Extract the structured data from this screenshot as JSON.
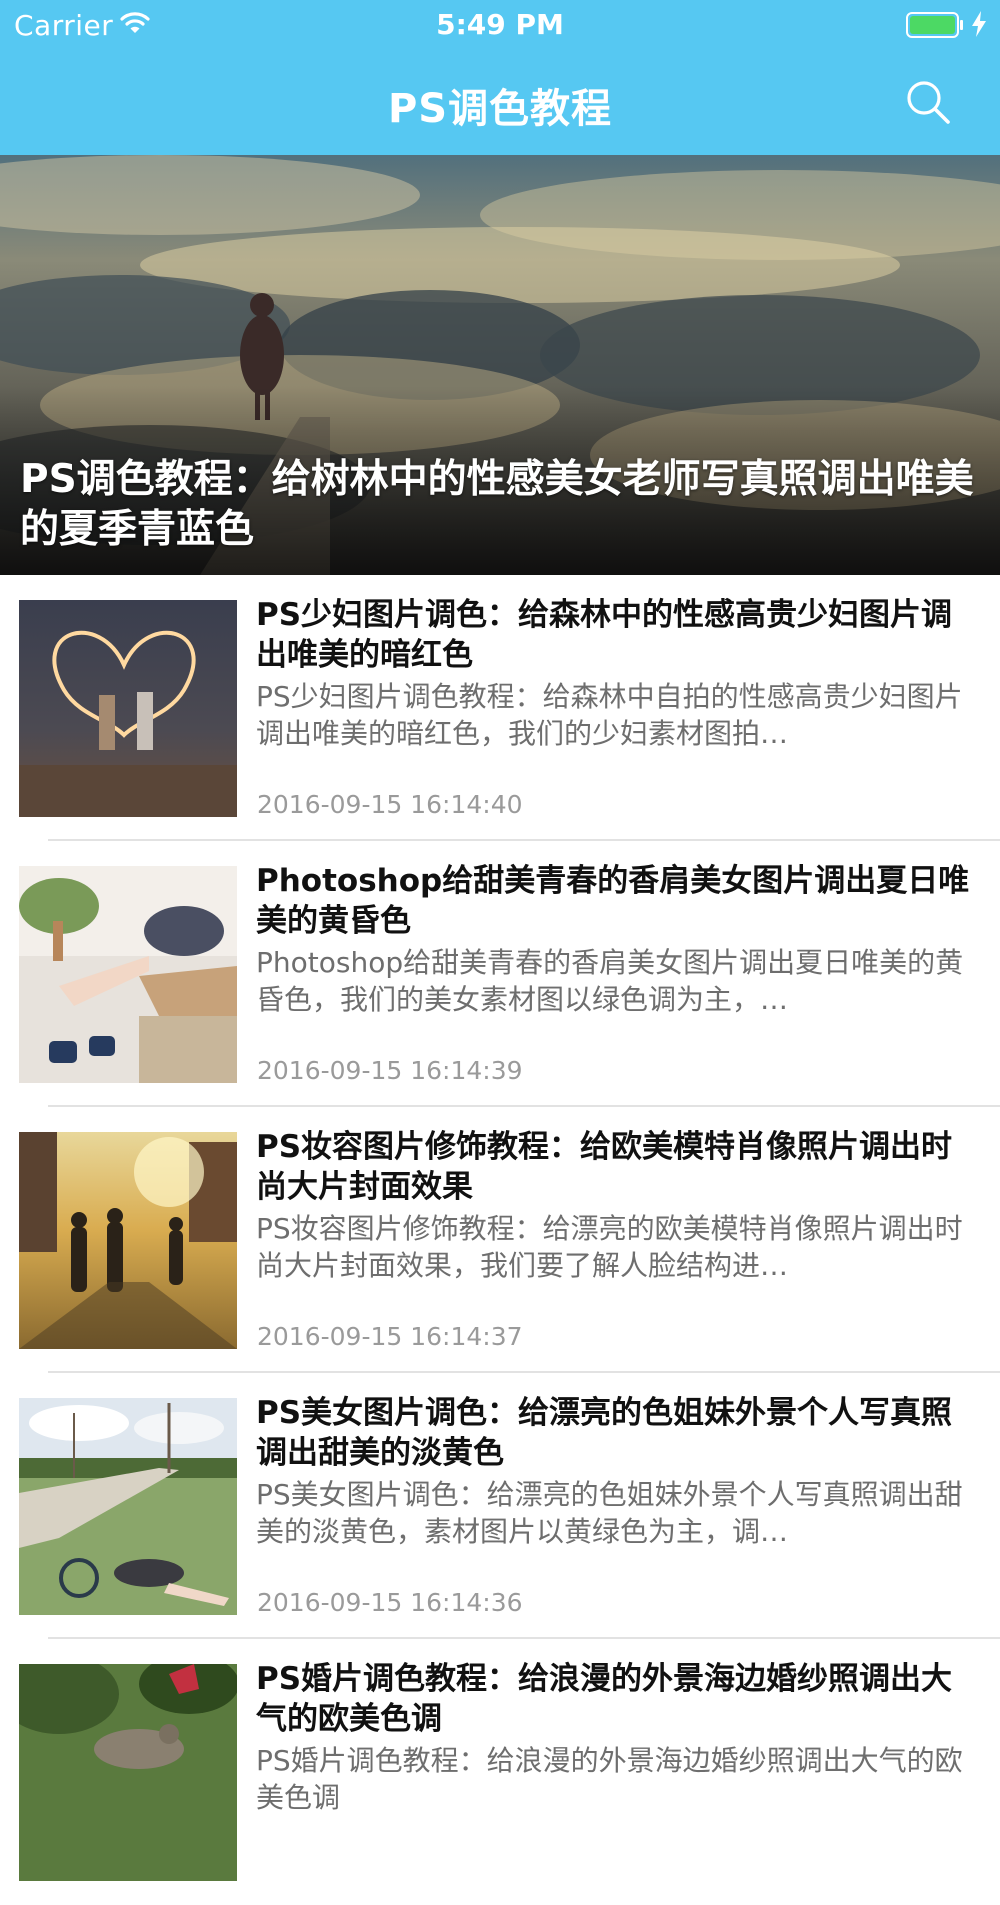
{
  "status_bar": {
    "carrier": "Carrier",
    "time": "5:49 PM",
    "battery_color": "#4cd964"
  },
  "nav": {
    "title": "PS调色教程",
    "background_color": "#56c8f2",
    "search_icon": "search-icon"
  },
  "hero": {
    "title": "PS调色教程：给树林中的性感美女老师写真照调出唯美的夏季青蓝色"
  },
  "articles": [
    {
      "title": "PS少妇图片调色：给森林中的性感高贵少妇图片调出唯美的暗红色",
      "summary": "PS少妇图片调色教程：给森林中自拍的性感高贵少妇图片调出唯美的暗红色，我们的少妇素材图拍…",
      "date": "2016-09-15 16:14:40"
    },
    {
      "title": "Photoshop给甜美青春的香肩美女图片调出夏日唯美的黄昏色",
      "summary": "Photoshop给甜美青春的香肩美女图片调出夏日唯美的黄昏色，我们的美女素材图以绿色调为主，…",
      "date": "2016-09-15 16:14:39"
    },
    {
      "title": "PS妆容图片修饰教程：给欧美模特肖像照片调出时尚大片封面效果",
      "summary": "PS妆容图片修饰教程：给漂亮的欧美模特肖像照片调出时尚大片封面效果，我们要了解人脸结构进…",
      "date": "2016-09-15 16:14:37"
    },
    {
      "title": "PS美女图片调色：给漂亮的色姐妹外景个人写真照调出甜美的淡黄色",
      "summary": "PS美女图片调色：给漂亮的色姐妹外景个人写真照调出甜美的淡黄色，素材图片以黄绿色为主，调…",
      "date": "2016-09-15 16:14:36"
    },
    {
      "title": "PS婚片调色教程：给浪漫的外景海边婚纱照调出大气的欧美色调",
      "summary": "PS婚片调色教程：给浪漫的外景海边婚纱照调出大气的欧美色调",
      "date": ""
    }
  ]
}
